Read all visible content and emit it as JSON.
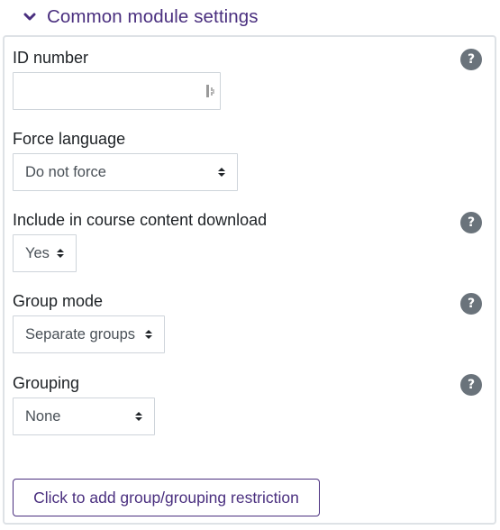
{
  "section": {
    "title": "Common module settings",
    "expanded": true,
    "accent_color": "#4a2f7f"
  },
  "fields": {
    "id_number": {
      "label": "ID number",
      "value": "",
      "has_help": true
    },
    "force_language": {
      "label": "Force language",
      "selected": "Do not force"
    },
    "download": {
      "label": "Include in course content download",
      "selected": "Yes",
      "has_help": true
    },
    "group_mode": {
      "label": "Group mode",
      "selected": "Separate groups",
      "has_help": true
    },
    "grouping": {
      "label": "Grouping",
      "selected": "None",
      "has_help": true
    }
  },
  "help_icon_text": "?",
  "restriction_button": {
    "label": "Click to add group/grouping restriction"
  }
}
